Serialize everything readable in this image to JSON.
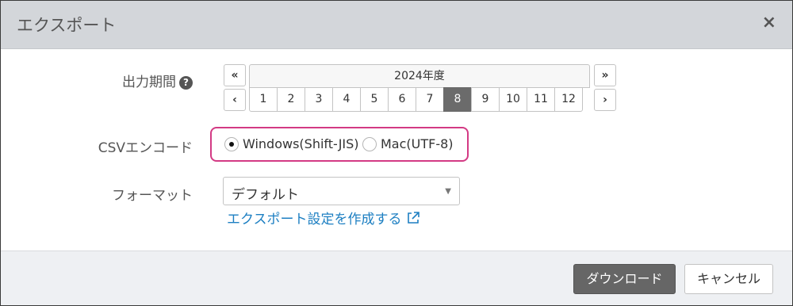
{
  "dialog": {
    "title": "エクスポート",
    "close_glyph": "×"
  },
  "period": {
    "label": "出力期間",
    "help_glyph": "?",
    "prev_year_glyph": "«",
    "next_year_glyph": "»",
    "prev_month_glyph": "‹",
    "next_month_glyph": "›",
    "year_label": "2024年度",
    "months": [
      "1",
      "2",
      "3",
      "4",
      "5",
      "6",
      "7",
      "8",
      "9",
      "10",
      "11",
      "12"
    ],
    "selected_month": "8"
  },
  "encoding": {
    "label": "CSVエンコード",
    "options": [
      {
        "label": "Windows(Shift-JIS)",
        "selected": true
      },
      {
        "label": "Mac(UTF-8)",
        "selected": false
      }
    ],
    "highlight_color": "#d33a84"
  },
  "format": {
    "label": "フォーマット",
    "selected_value": "デフォルト",
    "link_text": "エクスポート設定を作成する"
  },
  "footer": {
    "download_label": "ダウンロード",
    "cancel_label": "キャンセル"
  },
  "colors": {
    "header_bg": "#d3d6da",
    "link": "#1d7fc2",
    "primary_button": "#666666",
    "active_month": "#6b6b6b"
  }
}
